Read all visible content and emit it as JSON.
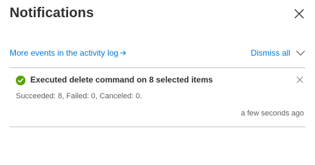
{
  "panel": {
    "title": "Notifications",
    "close_icon": "close-icon"
  },
  "toolbar": {
    "activity_link": "More events in the activity log",
    "activity_link_icon": "arrow-right-icon",
    "dismiss_all": "Dismiss all",
    "dismiss_all_icon": "chevron-down-icon"
  },
  "notification": {
    "status_icon": "success-check-icon",
    "status_color": "#57a300",
    "title": "Executed delete command on 8 selected items",
    "body": "Succeeded: 8, Failed: 0, Canceled: 0.",
    "time": "a few seconds ago",
    "dismiss_icon": "close-icon"
  },
  "colors": {
    "link": "#0078d4",
    "text": "#323130",
    "secondary_text": "#605e5c",
    "divider": "#c8c6c4"
  }
}
